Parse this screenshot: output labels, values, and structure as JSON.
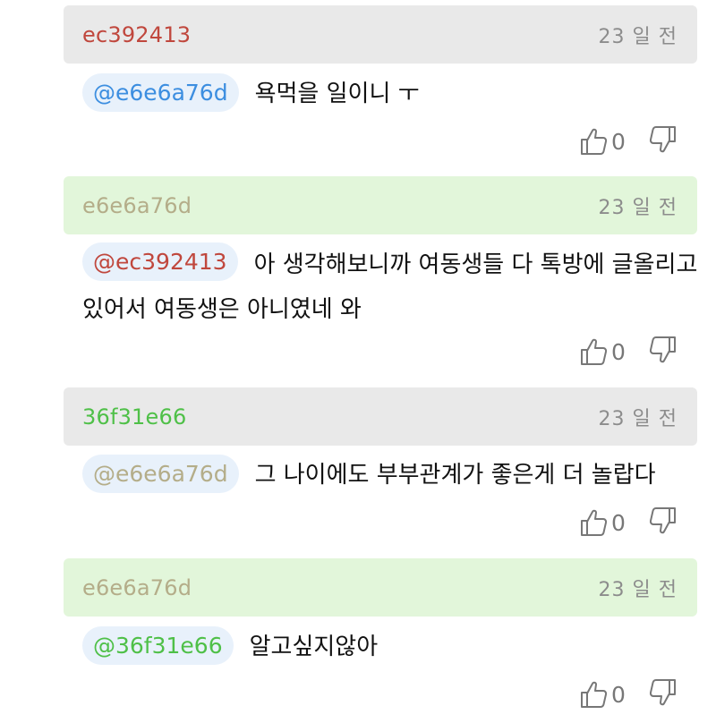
{
  "comments": [
    {
      "author": "ec392413",
      "author_color": "#c0473d",
      "time": "23 일 전",
      "mention": "@e6e6a76d",
      "mention_color": "#3c8ee0",
      "text": "욕먹을 일이니 ㅜ",
      "likes": "0"
    },
    {
      "author": "e6e6a76d",
      "author_color": "#b4ad89",
      "time": "23 일 전",
      "mention": "@ec392413",
      "mention_color": "#c0473d",
      "text": "아 생각해보니까 여동생들 다 톡방에 글올리고 있어서 여동생은 아니였네 와",
      "likes": "0"
    },
    {
      "author": "36f31e66",
      "author_color": "#4fc048",
      "time": "23 일 전",
      "mention": "@e6e6a76d",
      "mention_color": "#b4ad89",
      "text": "그 나이에도 부부관계가 좋은게 더 놀랍다",
      "likes": "0"
    },
    {
      "author": "e6e6a76d",
      "author_color": "#b4ad89",
      "time": "23 일 전",
      "mention": "@36f31e66",
      "mention_color": "#4fc048",
      "text": "알고싶지않아",
      "likes": "0"
    }
  ],
  "icons": {
    "like": "thumbs-up-icon",
    "dislike": "thumbs-down-icon"
  }
}
